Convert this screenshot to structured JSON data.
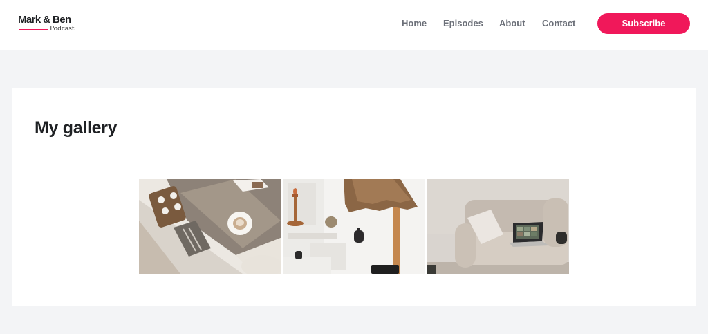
{
  "brand": {
    "name": "Mark & Ben",
    "tagline": "Podcast",
    "accent_color": "#f0185a"
  },
  "nav": {
    "items": [
      {
        "label": "Home"
      },
      {
        "label": "Episodes"
      },
      {
        "label": "About"
      },
      {
        "label": "Contact"
      }
    ],
    "subscribe_label": "Subscribe"
  },
  "main": {
    "title": "My gallery",
    "gallery": [
      {
        "subject": "coffee-table-photo"
      },
      {
        "subject": "shelf-lamp-photo"
      },
      {
        "subject": "sofa-laptop-photo"
      }
    ]
  }
}
